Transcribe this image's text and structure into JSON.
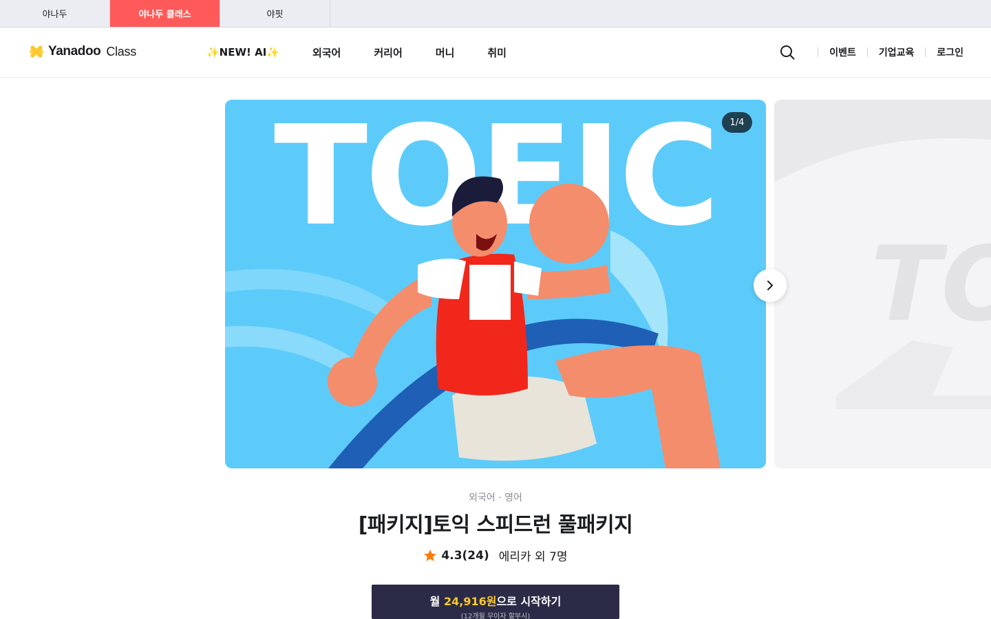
{
  "top_tabs": [
    {
      "label": "야나두"
    },
    {
      "label": "야나두 클래스"
    },
    {
      "label": "야핏"
    }
  ],
  "header": {
    "logo_text": "Yanadoo",
    "logo_sub": "Class",
    "nav": [
      {
        "label": "✨NEW! AI✨"
      },
      {
        "label": "외국어"
      },
      {
        "label": "커리어"
      },
      {
        "label": "머니"
      },
      {
        "label": "취미"
      }
    ],
    "util": {
      "event": "이벤트",
      "corporate": "기업교육",
      "login": "로그인"
    }
  },
  "carousel": {
    "counter": "1/4",
    "banner_text": "TOEIC",
    "next_banner_text": "TO"
  },
  "product": {
    "category": "외국어 · 영어",
    "title": "[패키지]토익 스피드런 풀패키지",
    "rating": "4.3(24)",
    "author": "에리카 외 7명",
    "cta_prefix": "월 ",
    "cta_price": "24,916원",
    "cta_suffix": "으로 시작하기",
    "cta_sub": "(12개월 무이자 할부시)"
  },
  "colors": {
    "active_tab": "#ff5a5a",
    "banner_bg": "#5ccbfa",
    "cta_bg": "#2b2b47",
    "cta_price": "#ffc82c",
    "star": "#ff7a00"
  }
}
